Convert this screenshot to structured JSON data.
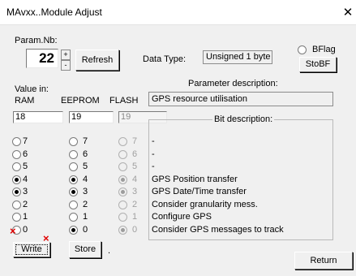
{
  "window": {
    "title": "MAvxx..Module Adjust",
    "close_glyph": "✕"
  },
  "param": {
    "label": "Param.Nb:",
    "value": "22",
    "spin_up": "+",
    "spin_down": "-",
    "refresh_label": "Refresh"
  },
  "data_type": {
    "label": "Data Type:",
    "value": "Unsigned 1 byte"
  },
  "bflag": {
    "label": "BFlag",
    "sto_label": "StoBF"
  },
  "value_in": {
    "label": "Value in:",
    "ram_header": "RAM",
    "eeprom_header": "EEPROM",
    "flash_header": "FLASH",
    "ram_value": "18",
    "eeprom_value": "19",
    "flash_value": "19"
  },
  "param_desc": {
    "label": "Parameter description:",
    "value": "GPS resource utilisation"
  },
  "bit_desc": {
    "label": "Bit description:",
    "lines": [
      "-",
      "-",
      "-",
      "GPS Position transfer",
      "GPS Date/Time transfer",
      "Consider granularity mess.",
      "Configure GPS",
      "Consider GPS messages to track"
    ]
  },
  "bits": [
    "7",
    "6",
    "5",
    "4",
    "3",
    "2",
    "1",
    "0"
  ],
  "ram_checked": [
    false,
    false,
    false,
    true,
    true,
    false,
    false,
    false
  ],
  "eeprom_checked": [
    false,
    false,
    false,
    true,
    true,
    false,
    false,
    true
  ],
  "flash_checked": [
    false,
    false,
    false,
    true,
    true,
    false,
    false,
    true
  ],
  "buttons": {
    "write": "Write",
    "store": "Store",
    "status": ".",
    "return": "Return"
  },
  "markers": {
    "x_glyph": "×"
  },
  "colors": {
    "marker": "#e00000"
  }
}
